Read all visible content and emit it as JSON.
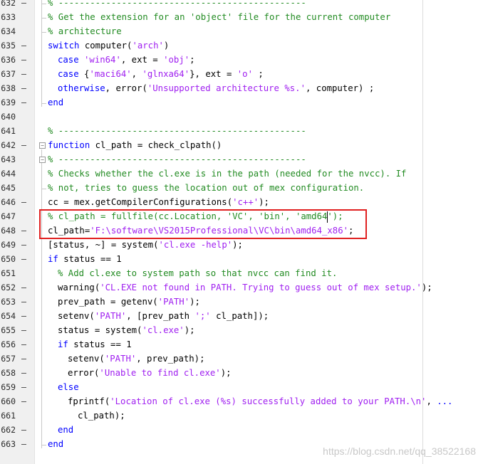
{
  "editor": {
    "lines": [
      {
        "no": "632",
        "dash": true,
        "fold": "end",
        "ind": 0,
        "tokens": [
          {
            "t": "c",
            "v": "% -----------------------------------------------"
          }
        ]
      },
      {
        "no": "633",
        "dash": false,
        "fold": "end",
        "ind": 0,
        "tokens": [
          {
            "t": "c",
            "v": "% Get the extension for an 'object' file for the current computer"
          }
        ]
      },
      {
        "no": "634",
        "dash": false,
        "fold": "end",
        "ind": 0,
        "tokens": [
          {
            "t": "c",
            "v": "% architecture"
          }
        ]
      },
      {
        "no": "635",
        "dash": true,
        "fold": "",
        "ind": 0,
        "tokens": [
          {
            "t": "k",
            "v": "switch"
          },
          {
            "t": "p",
            "v": " computer("
          },
          {
            "t": "s",
            "v": "'arch'"
          },
          {
            "t": "p",
            "v": ")"
          }
        ]
      },
      {
        "no": "636",
        "dash": true,
        "fold": "",
        "ind": 1,
        "tokens": [
          {
            "t": "k",
            "v": "case"
          },
          {
            "t": "p",
            "v": " "
          },
          {
            "t": "s",
            "v": "'win64'"
          },
          {
            "t": "p",
            "v": ", ext = "
          },
          {
            "t": "s",
            "v": "'obj'"
          },
          {
            "t": "p",
            "v": ";"
          }
        ]
      },
      {
        "no": "637",
        "dash": true,
        "fold": "",
        "ind": 1,
        "tokens": [
          {
            "t": "k",
            "v": "case"
          },
          {
            "t": "p",
            "v": " {"
          },
          {
            "t": "s",
            "v": "'maci64'"
          },
          {
            "t": "p",
            "v": ", "
          },
          {
            "t": "s",
            "v": "'glnxa64'"
          },
          {
            "t": "p",
            "v": "}, ext = "
          },
          {
            "t": "s",
            "v": "'o'"
          },
          {
            "t": "p",
            "v": " ;"
          }
        ]
      },
      {
        "no": "638",
        "dash": true,
        "fold": "",
        "ind": 1,
        "tokens": [
          {
            "t": "k",
            "v": "otherwise"
          },
          {
            "t": "p",
            "v": ", error("
          },
          {
            "t": "s",
            "v": "'Unsupported architecture %s.'"
          },
          {
            "t": "p",
            "v": ", computer) ;"
          }
        ]
      },
      {
        "no": "639",
        "dash": true,
        "fold": "close",
        "ind": 0,
        "tokens": [
          {
            "t": "k",
            "v": "end"
          }
        ]
      },
      {
        "no": "640",
        "dash": false,
        "fold": "",
        "ind": 0,
        "tokens": []
      },
      {
        "no": "641",
        "dash": false,
        "fold": "",
        "ind": 0,
        "tokens": [
          {
            "t": "c",
            "v": "% -----------------------------------------------"
          }
        ]
      },
      {
        "no": "642",
        "dash": true,
        "fold": "open",
        "ind": 0,
        "tokens": [
          {
            "t": "k",
            "v": "function"
          },
          {
            "t": "p",
            "v": " cl_path = check_clpath()"
          }
        ]
      },
      {
        "no": "643",
        "dash": false,
        "fold": "open2",
        "ind": 0,
        "tokens": [
          {
            "t": "c",
            "v": "% -----------------------------------------------"
          }
        ]
      },
      {
        "no": "644",
        "dash": false,
        "fold": "",
        "ind": 0,
        "tokens": [
          {
            "t": "c",
            "v": "% Checks whether the cl.exe is in the path (needed for the nvcc). If"
          }
        ]
      },
      {
        "no": "645",
        "dash": false,
        "fold": "end",
        "ind": 0,
        "tokens": [
          {
            "t": "c",
            "v": "% not, tries to guess the location out of mex configuration."
          }
        ]
      },
      {
        "no": "646",
        "dash": true,
        "fold": "",
        "ind": 0,
        "tokens": [
          {
            "t": "p",
            "v": "cc = mex.getCompilerConfigurations("
          },
          {
            "t": "s",
            "v": "'c++'"
          },
          {
            "t": "p",
            "v": ");"
          }
        ]
      },
      {
        "no": "647",
        "dash": false,
        "fold": "",
        "ind": 0,
        "tokens": [
          {
            "t": "c",
            "v": "% cl_path = fullfile(cc.Location, 'VC', 'bin', 'amd64');"
          }
        ]
      },
      {
        "no": "648",
        "dash": true,
        "fold": "",
        "ind": 0,
        "tokens": [
          {
            "t": "p",
            "v": "cl_path="
          },
          {
            "t": "s",
            "v": "'F:\\software\\VS2015Professional\\VC\\bin\\amd64_x86'"
          },
          {
            "t": "p",
            "v": ";"
          }
        ]
      },
      {
        "no": "649",
        "dash": true,
        "fold": "",
        "ind": 0,
        "tokens": [
          {
            "t": "p",
            "v": "[status, ~] = system("
          },
          {
            "t": "s",
            "v": "'cl.exe -help'"
          },
          {
            "t": "p",
            "v": ");"
          }
        ]
      },
      {
        "no": "650",
        "dash": true,
        "fold": "",
        "ind": 0,
        "tokens": [
          {
            "t": "k",
            "v": "if"
          },
          {
            "t": "p",
            "v": " status == 1"
          }
        ]
      },
      {
        "no": "651",
        "dash": false,
        "fold": "",
        "ind": 1,
        "tokens": [
          {
            "t": "c",
            "v": "% Add cl.exe to system path so that nvcc can find it."
          }
        ]
      },
      {
        "no": "652",
        "dash": true,
        "fold": "",
        "ind": 1,
        "tokens": [
          {
            "t": "p",
            "v": "warning("
          },
          {
            "t": "s",
            "v": "'CL.EXE not found in PATH. Trying to guess out of mex setup.'"
          },
          {
            "t": "p",
            "v": ");"
          }
        ]
      },
      {
        "no": "653",
        "dash": true,
        "fold": "",
        "ind": 1,
        "tokens": [
          {
            "t": "p",
            "v": "prev_path = getenv("
          },
          {
            "t": "s",
            "v": "'PATH'"
          },
          {
            "t": "p",
            "v": ");"
          }
        ]
      },
      {
        "no": "654",
        "dash": true,
        "fold": "",
        "ind": 1,
        "tokens": [
          {
            "t": "p",
            "v": "setenv("
          },
          {
            "t": "s",
            "v": "'PATH'"
          },
          {
            "t": "p",
            "v": ", [prev_path "
          },
          {
            "t": "s",
            "v": "';'"
          },
          {
            "t": "p",
            "v": " cl_path]);"
          }
        ]
      },
      {
        "no": "655",
        "dash": true,
        "fold": "",
        "ind": 1,
        "tokens": [
          {
            "t": "p",
            "v": "status = system("
          },
          {
            "t": "s",
            "v": "'cl.exe'"
          },
          {
            "t": "p",
            "v": ");"
          }
        ]
      },
      {
        "no": "656",
        "dash": true,
        "fold": "",
        "ind": 1,
        "tokens": [
          {
            "t": "k",
            "v": "if"
          },
          {
            "t": "p",
            "v": " status == 1"
          }
        ]
      },
      {
        "no": "657",
        "dash": true,
        "fold": "",
        "ind": 2,
        "tokens": [
          {
            "t": "p",
            "v": "setenv("
          },
          {
            "t": "s",
            "v": "'PATH'"
          },
          {
            "t": "p",
            "v": ", prev_path);"
          }
        ]
      },
      {
        "no": "658",
        "dash": true,
        "fold": "",
        "ind": 2,
        "tokens": [
          {
            "t": "p",
            "v": "error("
          },
          {
            "t": "s",
            "v": "'Unable to find cl.exe'"
          },
          {
            "t": "p",
            "v": ");"
          }
        ]
      },
      {
        "no": "659",
        "dash": true,
        "fold": "",
        "ind": 1,
        "tokens": [
          {
            "t": "k",
            "v": "else"
          }
        ]
      },
      {
        "no": "660",
        "dash": true,
        "fold": "",
        "ind": 2,
        "tokens": [
          {
            "t": "p",
            "v": "fprintf("
          },
          {
            "t": "s",
            "v": "'Location of cl.exe (%s) successfully added to your PATH.\\n'"
          },
          {
            "t": "p",
            "v": ", "
          },
          {
            "t": "k",
            "v": "..."
          }
        ]
      },
      {
        "no": "661",
        "dash": false,
        "fold": "",
        "ind": 3,
        "tokens": [
          {
            "t": "p",
            "v": "cl_path);"
          }
        ]
      },
      {
        "no": "662",
        "dash": true,
        "fold": "",
        "ind": 1,
        "tokens": [
          {
            "t": "k",
            "v": "end"
          }
        ]
      },
      {
        "no": "663",
        "dash": true,
        "fold": "close",
        "ind": 0,
        "tokens": [
          {
            "t": "k",
            "v": "end"
          }
        ]
      }
    ]
  },
  "watermark": "https://blog.csdn.net/qq_38522168",
  "colors": {
    "keyword": "#0000ff",
    "string": "#a020f0",
    "comment": "#228b22",
    "highlight_box": "#e02020"
  }
}
